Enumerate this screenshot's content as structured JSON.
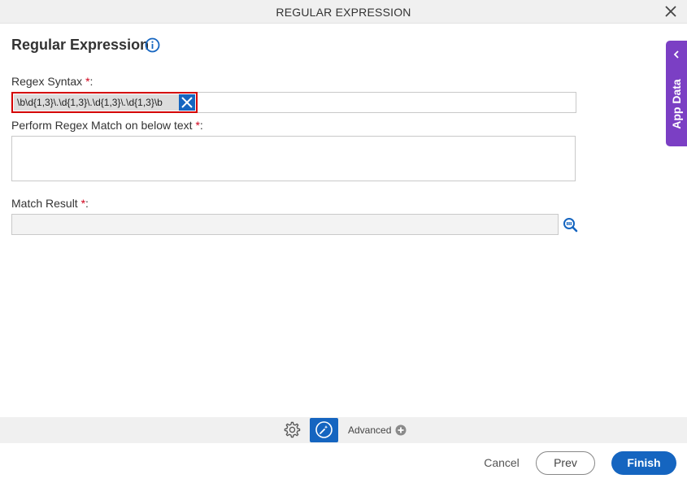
{
  "dialog": {
    "title": "REGULAR EXPRESSION",
    "heading": "Regular Expression"
  },
  "form": {
    "regex_syntax": {
      "label": "Regex Syntax",
      "required_mark": "*",
      "colon": ":",
      "value": "\\b\\d{1,3}\\.\\d{1,3}\\.\\d{1,3}\\.\\d{1,3}\\b"
    },
    "match_text": {
      "label": "Perform Regex Match on below text",
      "required_mark": "*",
      "colon": ":",
      "value": ""
    },
    "match_result": {
      "label": "Match Result",
      "required_mark": "*",
      "colon": ":",
      "value": ""
    }
  },
  "side_panel": {
    "label": "App Data"
  },
  "toolbar": {
    "advanced_label": "Advanced"
  },
  "footer": {
    "cancel_label": "Cancel",
    "prev_label": "Prev",
    "finish_label": "Finish"
  },
  "colors": {
    "primary": "#1565c0",
    "app_data_tab": "#7b3fc4",
    "required": "#d0021b",
    "highlight_border": "#d40000"
  },
  "icons": [
    "close-icon",
    "info-icon",
    "clear-icon",
    "lookup-icon",
    "chevron-left-icon",
    "gear-icon",
    "magic-wand-icon",
    "plus-circle-icon"
  ]
}
